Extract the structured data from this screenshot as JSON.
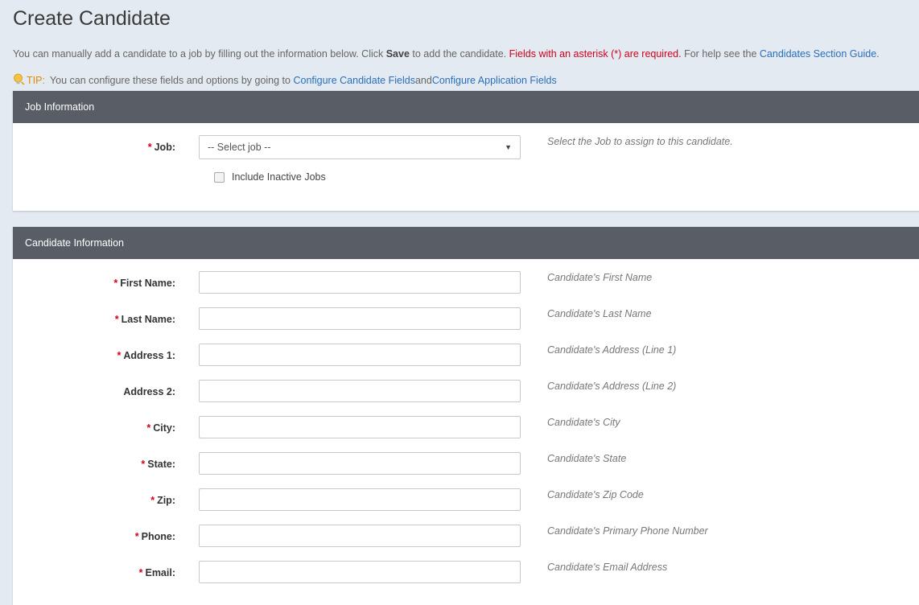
{
  "page": {
    "title": "Create Candidate"
  },
  "intro": {
    "text_start": "You can manually add a candidate to a job by filling out the information below. Click ",
    "save_word": "Save",
    "text_mid": " to add the candidate. ",
    "required_note": "Fields with an asterisk (*) are required.",
    "help_prefix": " For help see the ",
    "help_link": "Candidates Section Guide",
    "help_suffix": "."
  },
  "tip": {
    "icon": "lightbulb-icon",
    "label": "TIP:",
    "text": "You can configure these fields and options by going to ",
    "link1": "Configure Candidate Fields",
    "and": " and ",
    "link2": "Configure Application Fields"
  },
  "job_panel": {
    "heading": "Job Information",
    "job_label": "Job:",
    "job_select_value": "-- Select job --",
    "job_hint": "Select the Job to assign to this candidate.",
    "include_inactive_label": "Include Inactive Jobs"
  },
  "candidate_panel": {
    "heading": "Candidate Information",
    "fields": [
      {
        "label": "First Name:",
        "required": true,
        "hint": "Candidate's First Name",
        "value": ""
      },
      {
        "label": "Last Name:",
        "required": true,
        "hint": "Candidate's Last Name",
        "value": ""
      },
      {
        "label": "Address 1:",
        "required": true,
        "hint": "Candidate's Address (Line 1)",
        "value": ""
      },
      {
        "label": "Address 2:",
        "required": false,
        "hint": "Candidate's Address (Line 2)",
        "value": ""
      },
      {
        "label": "City:",
        "required": true,
        "hint": "Candidate's City",
        "value": ""
      },
      {
        "label": "State:",
        "required": true,
        "hint": "Candidate's State",
        "value": ""
      },
      {
        "label": "Zip:",
        "required": true,
        "hint": "Candidate's Zip Code",
        "value": ""
      },
      {
        "label": "Phone:",
        "required": true,
        "hint": "Candidate's Primary Phone Number",
        "value": ""
      },
      {
        "label": "Email:",
        "required": true,
        "hint": "Candidate's Email Address",
        "value": ""
      }
    ]
  },
  "required_marker": "*",
  "colors": {
    "background": "#e4eaf1",
    "panel_header": "#585d66",
    "required": "#d0021b",
    "link": "#2a6ebb",
    "tip": "#e08a00"
  }
}
